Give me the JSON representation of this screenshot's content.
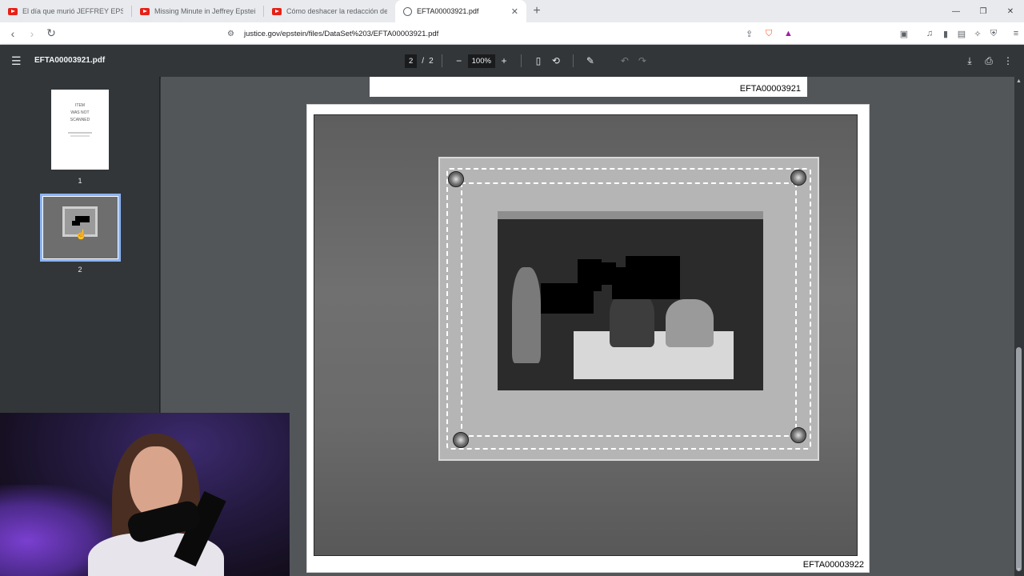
{
  "browser": {
    "tabs": [
      {
        "title": "El día que murió JEFFREY EPSTEIN - Y",
        "favicon": "youtube-icon",
        "active": false
      },
      {
        "title": "Missing Minute in Jeffrey Epstein Jail",
        "favicon": "youtube-icon",
        "active": false
      },
      {
        "title": "Cómo deshacer la redacción de los ar",
        "favicon": "youtube-icon",
        "active": false
      },
      {
        "title": "EFTA00003921.pdf",
        "favicon": "globe-icon",
        "active": true
      }
    ],
    "url": "justice.gov/epstein/files/DataSet%203/EFTA00003921.pdf"
  },
  "pdf_viewer": {
    "filename": "EFTA00003921.pdf",
    "current_page": "2",
    "page_separator": "/",
    "total_pages": "2",
    "zoom": "100%",
    "thumbnails": [
      {
        "label": "1",
        "lines": [
          "ITEM",
          "WAS NOT",
          "SCANNED"
        ]
      },
      {
        "label": "2"
      }
    ],
    "page1_footer_code": "EFTA00003921",
    "page2_footer_code": "EFTA00003922"
  },
  "colors": {
    "viewer_bg": "#525659",
    "toolbar_bg": "#323639",
    "thumb_highlight": "#8ab4f8",
    "youtube_red": "#e62117"
  }
}
